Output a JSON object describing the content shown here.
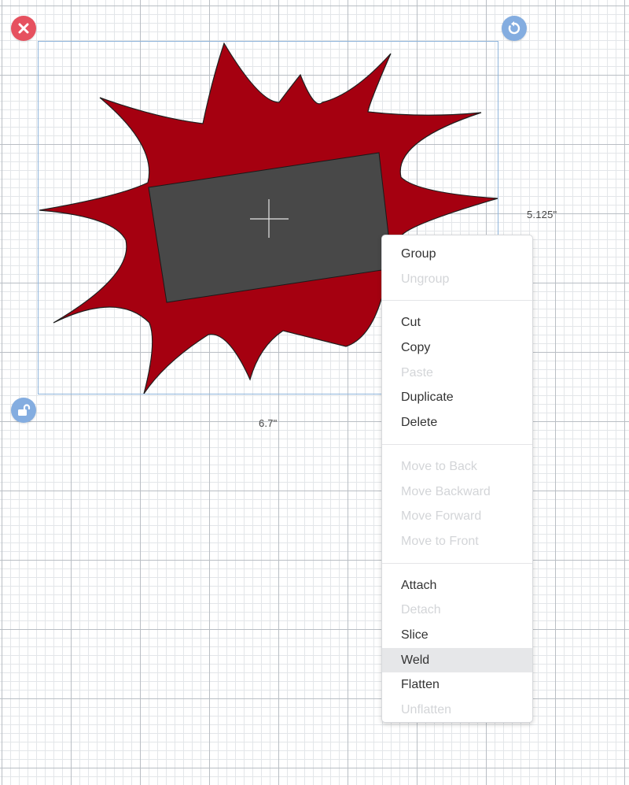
{
  "design": {
    "selection": {
      "width_label": "6.7\"",
      "height_label": "5.125\""
    },
    "colors": {
      "burst_fill": "#a50010",
      "rect_fill": "#484848",
      "selection_border": "#8fb5dc",
      "delete_handle": "#e6515f",
      "handle_blue": "#84ade0"
    },
    "icons": {
      "delete_handle": "close-icon",
      "rotate_handle": "rotate-icon",
      "lock_handle": "unlock-icon",
      "center_marker": "crosshair-icon"
    }
  },
  "context_menu": {
    "groups": [
      {
        "items": [
          {
            "label": "Group",
            "disabled": false
          },
          {
            "label": "Ungroup",
            "disabled": true
          }
        ]
      },
      {
        "items": [
          {
            "label": "Cut",
            "disabled": false
          },
          {
            "label": "Copy",
            "disabled": false
          },
          {
            "label": "Paste",
            "disabled": true
          },
          {
            "label": "Duplicate",
            "disabled": false
          },
          {
            "label": "Delete",
            "disabled": false
          }
        ]
      },
      {
        "items": [
          {
            "label": "Move to Back",
            "disabled": true
          },
          {
            "label": "Move Backward",
            "disabled": true
          },
          {
            "label": "Move Forward",
            "disabled": true
          },
          {
            "label": "Move to Front",
            "disabled": true
          }
        ]
      },
      {
        "items": [
          {
            "label": "Attach",
            "disabled": false
          },
          {
            "label": "Detach",
            "disabled": true
          },
          {
            "label": "Slice",
            "disabled": false
          },
          {
            "label": "Weld",
            "disabled": false,
            "hovered": true
          },
          {
            "label": "Flatten",
            "disabled": false
          },
          {
            "label": "Unflatten",
            "disabled": true
          }
        ]
      }
    ]
  }
}
